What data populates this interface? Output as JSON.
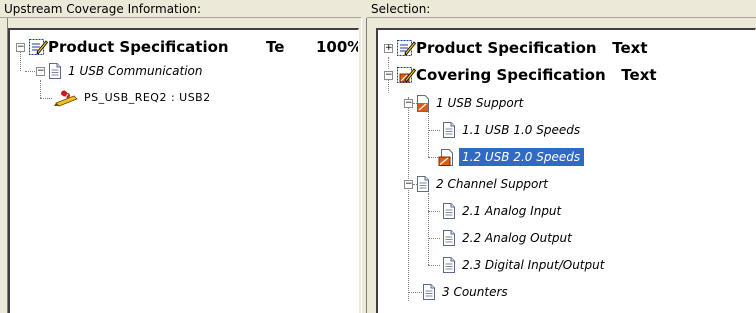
{
  "left_pane": {
    "header": "Upstream Coverage Information:",
    "root": {
      "title": "Product Specification",
      "suffix": "Te",
      "percent": "100%"
    },
    "child": {
      "label": "1 USB Communication"
    },
    "leaf": {
      "label": "PS_USB_REQ2 : USB2"
    }
  },
  "right_pane": {
    "header": "Selection:",
    "roots": [
      {
        "label": "Product Specification   Text",
        "expander": "+"
      },
      {
        "label": "Covering Specification   Text",
        "expander": "-"
      }
    ],
    "sections": [
      {
        "label": "1 USB Support"
      },
      {
        "label": "1.1 USB 1.0 Speeds"
      },
      {
        "label": "1.2 USB 2.0 Speeds",
        "selected": true
      },
      {
        "label": "2 Channel Support"
      },
      {
        "label": "2.1 Analog Input"
      },
      {
        "label": "2.2 Analog Output"
      },
      {
        "label": "2.3 Digital Input/Output"
      },
      {
        "label": "3 Counters"
      }
    ]
  },
  "colors": {
    "selection": "#316ac5",
    "panel": "#ece9d8"
  }
}
